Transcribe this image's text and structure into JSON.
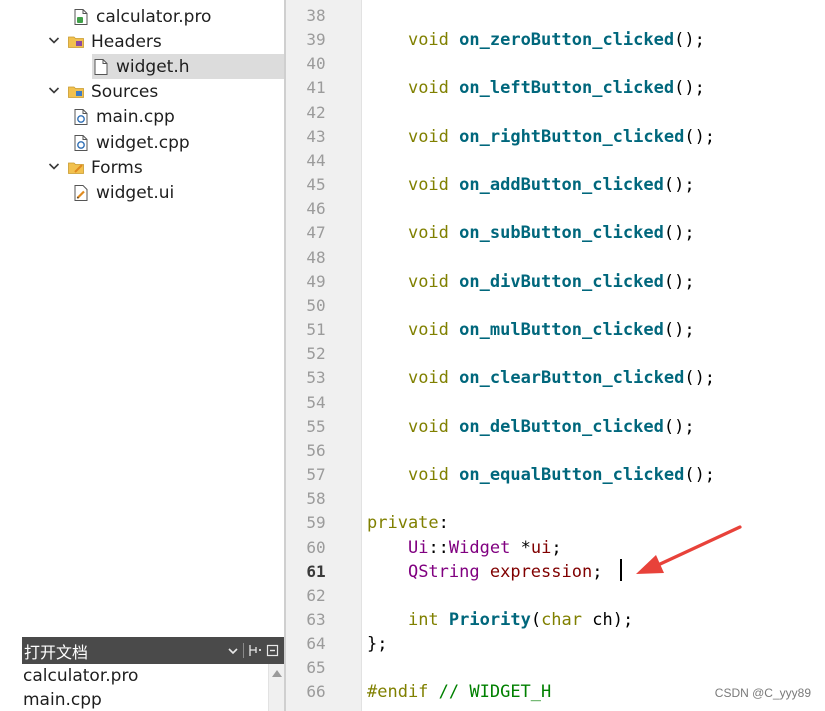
{
  "project_tree": {
    "items": [
      {
        "label": "calculator.pro",
        "icon": "pro-file-icon",
        "level": 1,
        "expandable": false,
        "selected": false
      },
      {
        "label": "Headers",
        "icon": "headers-folder-icon",
        "level": 0,
        "expandable": true,
        "selected": false
      },
      {
        "label": "widget.h",
        "icon": "header-file-icon",
        "level": 1,
        "expandable": false,
        "selected": true
      },
      {
        "label": "Sources",
        "icon": "sources-folder-icon",
        "level": 0,
        "expandable": true,
        "selected": false
      },
      {
        "label": "main.cpp",
        "icon": "cpp-file-icon",
        "level": 1,
        "expandable": false,
        "selected": false
      },
      {
        "label": "widget.cpp",
        "icon": "cpp-file-icon",
        "level": 1,
        "expandable": false,
        "selected": false
      },
      {
        "label": "Forms",
        "icon": "forms-folder-icon",
        "level": 0,
        "expandable": true,
        "selected": false
      },
      {
        "label": "widget.ui",
        "icon": "ui-file-icon",
        "level": 1,
        "expandable": false,
        "selected": false
      }
    ]
  },
  "open_documents": {
    "title": "打开文档",
    "controls": [
      "dropdown-icon",
      "split-icon",
      "close-panel-icon"
    ],
    "items": [
      "calculator.pro",
      "main.cpp"
    ]
  },
  "editor": {
    "current_line": 61,
    "lines": [
      {
        "no": 38,
        "segments": []
      },
      {
        "no": 39,
        "segments": [
          [
            "    ",
            "plain"
          ],
          [
            "void",
            "kw"
          ],
          [
            " ",
            "plain"
          ],
          [
            "on_zeroButton_clicked",
            "fn"
          ],
          [
            "();",
            "punc"
          ]
        ]
      },
      {
        "no": 40,
        "segments": []
      },
      {
        "no": 41,
        "segments": [
          [
            "    ",
            "plain"
          ],
          [
            "void",
            "kw"
          ],
          [
            " ",
            "plain"
          ],
          [
            "on_leftButton_clicked",
            "fn"
          ],
          [
            "();",
            "punc"
          ]
        ]
      },
      {
        "no": 42,
        "segments": []
      },
      {
        "no": 43,
        "segments": [
          [
            "    ",
            "plain"
          ],
          [
            "void",
            "kw"
          ],
          [
            " ",
            "plain"
          ],
          [
            "on_rightButton_clicked",
            "fn"
          ],
          [
            "();",
            "punc"
          ]
        ]
      },
      {
        "no": 44,
        "segments": []
      },
      {
        "no": 45,
        "segments": [
          [
            "    ",
            "plain"
          ],
          [
            "void",
            "kw"
          ],
          [
            " ",
            "plain"
          ],
          [
            "on_addButton_clicked",
            "fn"
          ],
          [
            "();",
            "punc"
          ]
        ]
      },
      {
        "no": 46,
        "segments": []
      },
      {
        "no": 47,
        "segments": [
          [
            "    ",
            "plain"
          ],
          [
            "void",
            "kw"
          ],
          [
            " ",
            "plain"
          ],
          [
            "on_subButton_clicked",
            "fn"
          ],
          [
            "();",
            "punc"
          ]
        ]
      },
      {
        "no": 48,
        "segments": []
      },
      {
        "no": 49,
        "segments": [
          [
            "    ",
            "plain"
          ],
          [
            "void",
            "kw"
          ],
          [
            " ",
            "plain"
          ],
          [
            "on_divButton_clicked",
            "fn"
          ],
          [
            "();",
            "punc"
          ]
        ]
      },
      {
        "no": 50,
        "segments": []
      },
      {
        "no": 51,
        "segments": [
          [
            "    ",
            "plain"
          ],
          [
            "void",
            "kw"
          ],
          [
            " ",
            "plain"
          ],
          [
            "on_mulButton_clicked",
            "fn"
          ],
          [
            "();",
            "punc"
          ]
        ]
      },
      {
        "no": 52,
        "segments": []
      },
      {
        "no": 53,
        "segments": [
          [
            "    ",
            "plain"
          ],
          [
            "void",
            "kw"
          ],
          [
            " ",
            "plain"
          ],
          [
            "on_clearButton_clicked",
            "fn"
          ],
          [
            "();",
            "punc"
          ]
        ]
      },
      {
        "no": 54,
        "segments": []
      },
      {
        "no": 55,
        "segments": [
          [
            "    ",
            "plain"
          ],
          [
            "void",
            "kw"
          ],
          [
            " ",
            "plain"
          ],
          [
            "on_delButton_clicked",
            "fn"
          ],
          [
            "();",
            "punc"
          ]
        ]
      },
      {
        "no": 56,
        "segments": []
      },
      {
        "no": 57,
        "segments": [
          [
            "    ",
            "plain"
          ],
          [
            "void",
            "kw"
          ],
          [
            " ",
            "plain"
          ],
          [
            "on_equalButton_clicked",
            "fn"
          ],
          [
            "();",
            "punc"
          ]
        ]
      },
      {
        "no": 58,
        "segments": []
      },
      {
        "no": 59,
        "segments": [
          [
            "private",
            "kw"
          ],
          [
            ":",
            "punc"
          ]
        ]
      },
      {
        "no": 60,
        "segments": [
          [
            "    ",
            "plain"
          ],
          [
            "Ui",
            "type"
          ],
          [
            "::",
            "punc"
          ],
          [
            "Widget",
            "type"
          ],
          [
            " *",
            "punc"
          ],
          [
            "ui",
            "var"
          ],
          [
            ";",
            "punc"
          ]
        ]
      },
      {
        "no": 61,
        "segments": [
          [
            "    ",
            "plain"
          ],
          [
            "QString",
            "type"
          ],
          [
            " ",
            "plain"
          ],
          [
            "expression",
            "var"
          ],
          [
            ";",
            "punc"
          ]
        ]
      },
      {
        "no": 62,
        "segments": []
      },
      {
        "no": 63,
        "segments": [
          [
            "    ",
            "plain"
          ],
          [
            "int",
            "kw"
          ],
          [
            " ",
            "plain"
          ],
          [
            "Priority",
            "fn"
          ],
          [
            "(",
            "punc"
          ],
          [
            "char",
            "kw"
          ],
          [
            " ",
            "plain"
          ],
          [
            "ch",
            "plain"
          ],
          [
            ");",
            "punc"
          ]
        ]
      },
      {
        "no": 64,
        "segments": [
          [
            "};",
            "punc"
          ]
        ]
      },
      {
        "no": 65,
        "segments": []
      },
      {
        "no": 66,
        "segments": [
          [
            "#endif",
            "kw"
          ],
          [
            " ",
            "plain"
          ],
          [
            "// WIDGET_H",
            "comment"
          ]
        ]
      }
    ]
  },
  "colors": {
    "keyword": "#808000",
    "function": "#00677c",
    "type": "#800080",
    "variable": "#800000",
    "comment": "#008000",
    "annotation_arrow": "#e8423a"
  },
  "watermark": "CSDN @C_yyy89"
}
